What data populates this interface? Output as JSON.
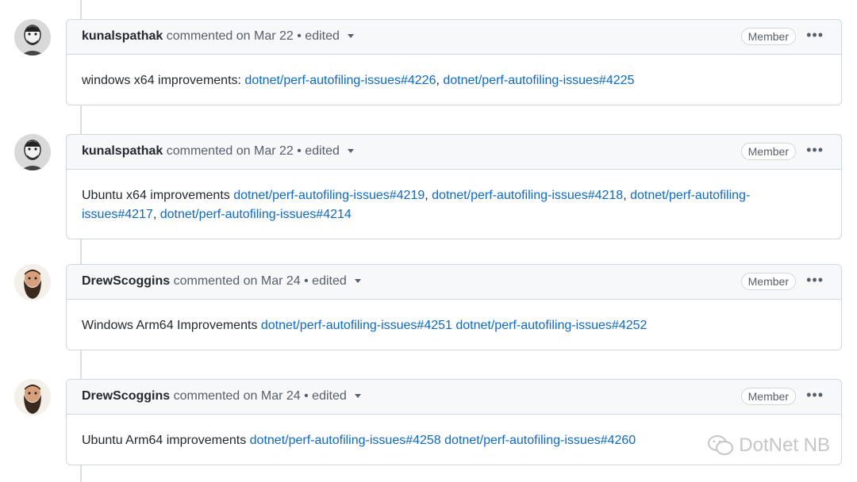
{
  "comments": [
    {
      "author": "kunalspathak",
      "meta": "commented on Mar 22 • edited",
      "badge": "Member",
      "avatar": "avatar-kunalspathak",
      "text": "windows x64 improvements: ",
      "links": [
        "dotnet/perf-autofiling-issues#4226",
        "dotnet/perf-autofiling-issues#4225"
      ]
    },
    {
      "author": "kunalspathak",
      "meta": "commented on Mar 22 • edited",
      "badge": "Member",
      "avatar": "avatar-kunalspathak",
      "text": "Ubuntu x64 improvements ",
      "links": [
        "dotnet/perf-autofiling-issues#4219",
        "dotnet/perf-autofiling-issues#4218",
        "dotnet/perf-autofiling-issues#4217",
        "dotnet/perf-autofiling-issues#4214"
      ]
    },
    {
      "author": "DrewScoggins",
      "meta": "commented on Mar 24 • edited",
      "badge": "Member",
      "avatar": "avatar-drewscoggins",
      "text": "Windows Arm64 Improvements ",
      "links": [
        "dotnet/perf-autofiling-issues#4251",
        "dotnet/perf-autofiling-issues#4252"
      ]
    },
    {
      "author": "DrewScoggins",
      "meta": "commented on Mar 24 • edited",
      "badge": "Member",
      "avatar": "avatar-drewscoggins",
      "text": "Ubuntu Arm64 improvements ",
      "links": [
        "dotnet/perf-autofiling-issues#4258",
        "dotnet/perf-autofiling-issues#4260"
      ]
    }
  ],
  "menu_icon": "kebab-horizontal-icon",
  "watermark": {
    "text": "DotNet NB",
    "icon": "wechat-icon"
  },
  "colors": {
    "link": "#0969da",
    "border": "#d0d7de",
    "header_bg": "#f6f8fa"
  }
}
